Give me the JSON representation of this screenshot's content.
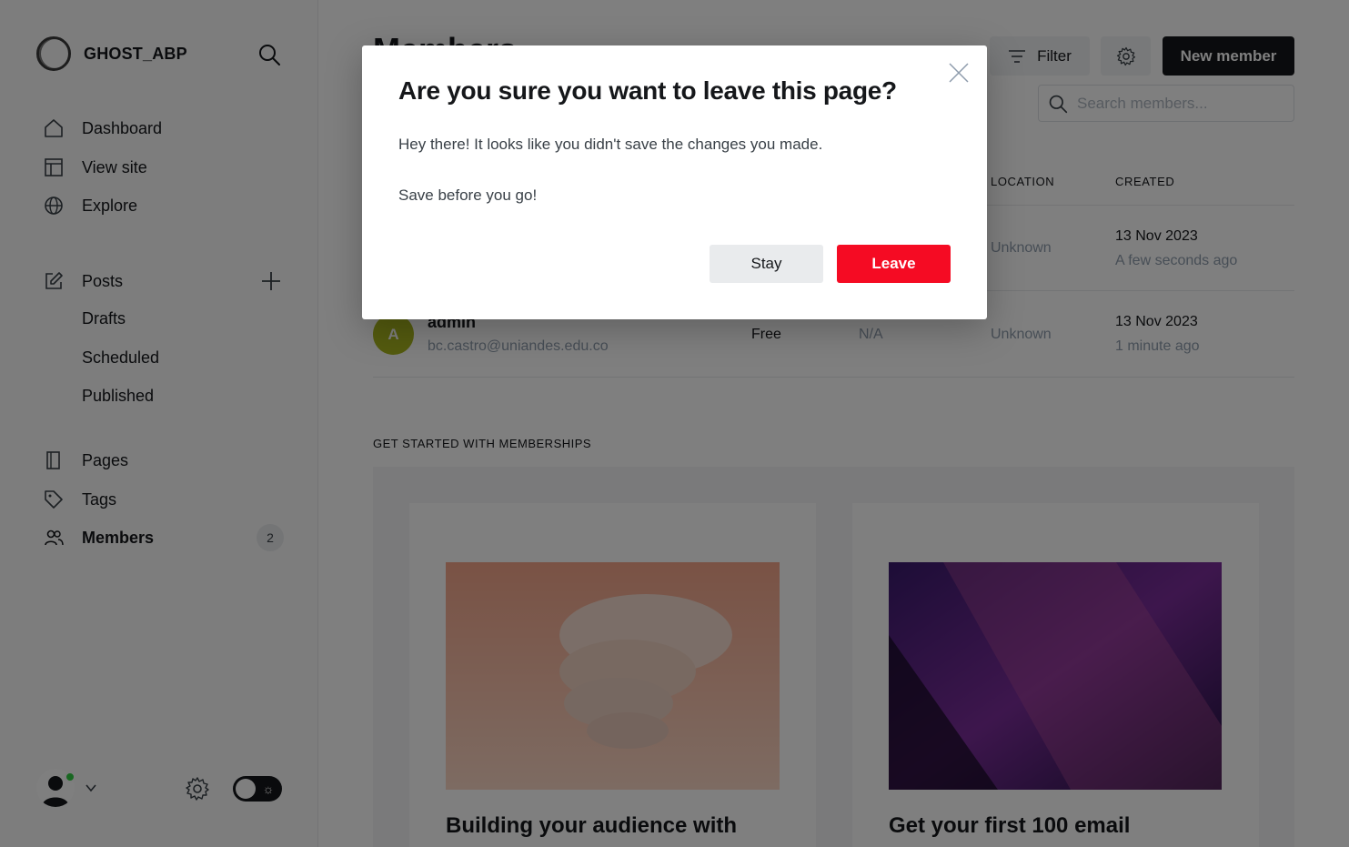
{
  "brand": {
    "name": "GHOST_ABP"
  },
  "nav": {
    "dashboard": "Dashboard",
    "view_site": "View site",
    "explore": "Explore",
    "posts": "Posts",
    "drafts": "Drafts",
    "scheduled": "Scheduled",
    "published": "Published",
    "pages": "Pages",
    "tags": "Tags",
    "members": "Members",
    "members_count": "2"
  },
  "header": {
    "filter_label": "Filter",
    "new_member_label": "New member",
    "search_placeholder": "Search members..."
  },
  "table": {
    "columns": {
      "location": "LOCATION",
      "created": "CREATED"
    },
    "rows": [
      {
        "location": "Unknown",
        "created_date": "13 Nov 2023",
        "created_ago": "A few seconds ago"
      },
      {
        "initial": "A",
        "name": "admin",
        "email": "bc.castro@uniandes.edu.co",
        "status": "Free",
        "open_rate": "N/A",
        "location": "Unknown",
        "created_date": "13 Nov 2023",
        "created_ago": "1 minute ago"
      }
    ]
  },
  "get_started": {
    "title": "GET STARTED WITH MEMBERSHIPS",
    "cards": [
      {
        "title": "Building your audience with"
      },
      {
        "title": "Get your first 100 email"
      }
    ]
  },
  "modal": {
    "title": "Are you sure you want to leave this page?",
    "body1": "Hey there! It looks like you didn't save the changes you made.",
    "body2": "Save before you go!",
    "stay_label": "Stay",
    "leave_label": "Leave"
  },
  "colors": {
    "accent_red": "#f50b23",
    "online_green": "#30cf43",
    "avatar_olive": "#a8b61e"
  }
}
